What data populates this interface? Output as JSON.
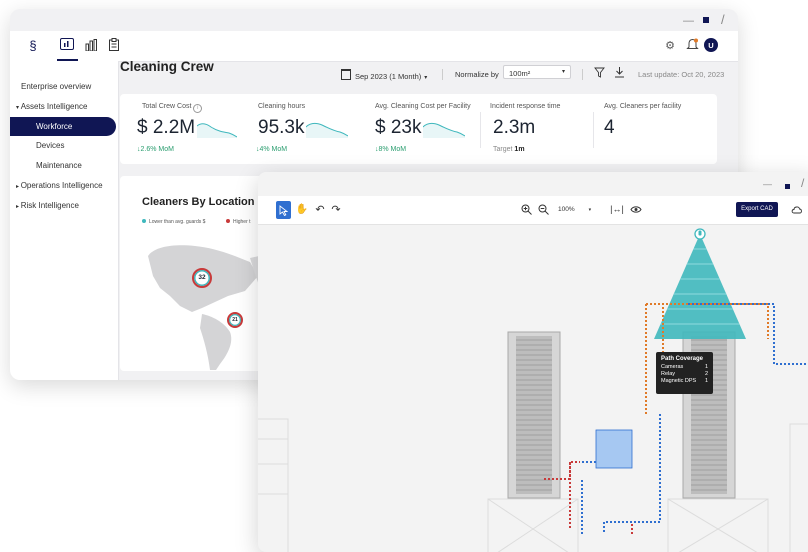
{
  "dashboard": {
    "title": "Cleaning Crew",
    "date_range": "Sep 2023 (1 Month)",
    "normalize_label": "Normalize by",
    "normalize_value": "100m²",
    "last_update": "Last update: Oct 20, 2023",
    "avatar_initial": "U",
    "sidebar": {
      "enterprise": "Enterprise overview",
      "assets": "Assets Intelligence",
      "workforce": "Workforce",
      "devices": "Devices",
      "maintenance": "Maintenance",
      "operations": "Operations Intelligence",
      "risk": "Risk Intelligence"
    },
    "metrics": [
      {
        "label": "Total Crew Cost",
        "value": "$ 2.2M",
        "delta": "↓2.6% MoM"
      },
      {
        "label": "Cleaning hours",
        "value": "95.3k",
        "delta": "↓4% MoM"
      },
      {
        "label": "Avg. Cleaning Cost per Facility",
        "value": "$ 23k",
        "delta": "↓8% MoM"
      },
      {
        "label": "Incident response time",
        "value": "2.3m",
        "target_label": "Target",
        "target_value": "1m"
      },
      {
        "label": "Avg. Cleaners per facility",
        "value": "4"
      }
    ],
    "map": {
      "title": "Cleaners By Location",
      "legend_lower": "Lower than avg. guards $",
      "legend_higher": "Higher t",
      "marker_a": "32",
      "marker_b": "21"
    }
  },
  "cad": {
    "zoom": "100%",
    "export_label": "Export CAD",
    "tooltip": {
      "title": "Path Coverage",
      "rows": [
        {
          "label": "Cameras",
          "value": "1"
        },
        {
          "label": "Relay",
          "value": "2"
        },
        {
          "label": "Magnetic DPS",
          "value": "1"
        }
      ]
    }
  },
  "colors": {
    "navy": "#101654",
    "teal": "#3fb8bd",
    "green": "#2a9d6f",
    "red": "#c83a3a",
    "blue": "#2f6fd0",
    "orange": "#e07a28",
    "lightblue": "#a6c8f2"
  }
}
